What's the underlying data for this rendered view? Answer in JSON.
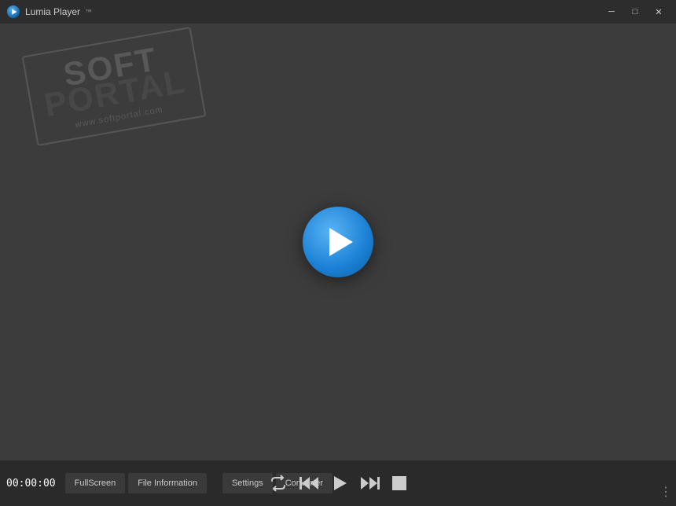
{
  "app": {
    "title": "Lumia Player",
    "icon": "play-icon"
  },
  "window_controls": {
    "minimize": "─",
    "maximize": "□",
    "close": "✕"
  },
  "watermark": {
    "soft": "SOFT",
    "portal": "PORTAL",
    "url": "www.softportal.com"
  },
  "time": {
    "current": "00:00:00"
  },
  "bottom_buttons": {
    "fullscreen": "FullScreen",
    "file_info": "File Information",
    "settings": "Settings",
    "converter": "Converter"
  },
  "colors": {
    "background": "#3c3c3c",
    "titlebar": "#2d2d2d",
    "bottombar": "#2a2a2a",
    "btn_bg": "#3a3a3a",
    "play_btn_gradient_start": "#5ab4f5",
    "play_btn_gradient_end": "#0e5fa0"
  }
}
